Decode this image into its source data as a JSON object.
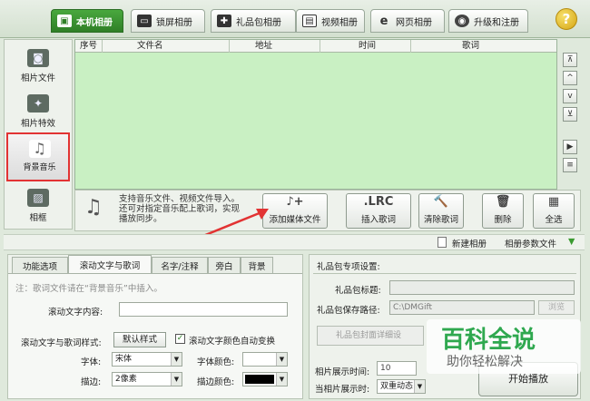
{
  "tabs": [
    {
      "label": "本机相册",
      "icon": "photo-icon",
      "active": true
    },
    {
      "label": "锁屏相册",
      "icon": "monitor-icon"
    },
    {
      "label": "礼品包相册",
      "icon": "gift-icon"
    },
    {
      "label": "视频相册",
      "icon": "film-icon"
    },
    {
      "label": "网页相册",
      "icon": "ie-icon"
    },
    {
      "label": "升级和注册",
      "icon": "globe-icon"
    }
  ],
  "help_label": "?",
  "sidebar": [
    {
      "label": "相片文件",
      "icon": "camera-icon"
    },
    {
      "label": "相片特效",
      "icon": "sparkle-icon"
    },
    {
      "label": "背景音乐",
      "icon": "music-note-icon",
      "selected": true
    },
    {
      "label": "相框",
      "icon": "frame-icon"
    }
  ],
  "table": {
    "columns": [
      "序号",
      "文件名",
      "地址",
      "时间",
      "歌词"
    ]
  },
  "right_buttons": [
    "⊼",
    "^",
    "v",
    "⊻",
    "▶",
    "≡"
  ],
  "toolbar": {
    "hint": "支持音乐文件、视频文件导入。还可对指定音乐配上歌词，实现播放同步。",
    "buttons": [
      {
        "label": "添加媒体文件",
        "icon": "add-music-icon",
        "glyph": "♪+"
      },
      {
        "label": "插入歌词",
        "icon": "lrc-icon",
        "glyph": ".LRC"
      },
      {
        "label": "清除歌词",
        "icon": "hammer-icon",
        "glyph": "🔨"
      },
      {
        "label": "删除",
        "icon": "trash-icon",
        "glyph": "🗑"
      },
      {
        "label": "全选",
        "icon": "grid-icon",
        "glyph": "▦"
      }
    ]
  },
  "statusbar": {
    "new_album": "新建相册",
    "album_params": "相册参数文件"
  },
  "lower_tabs": [
    "功能选项",
    "滚动文字与歌词",
    "名字/注释",
    "旁白",
    "背景"
  ],
  "lower_active_tab": 1,
  "scroll_panel": {
    "note": "注：歌词文件请在“背景音乐”中插入。",
    "content_label": "滚动文字内容:",
    "style_label": "滚动文字与歌词样式:",
    "default_style_btn": "默认样式",
    "auto_color_label": "滚动文字颜色自动变换",
    "font_label": "字体:",
    "font_value": "宋体",
    "font_color_label": "字体颜色:",
    "stroke_label": "描边:",
    "stroke_value": "2像素",
    "stroke_color_label": "描边颜色:"
  },
  "gift_panel": {
    "title": "礼品包专项设置:",
    "gift_title_label": "礼品包标题:",
    "path_label": "礼品包保存路径:",
    "path_value": "C:\\DMGift",
    "browse_label": "浏览",
    "cover_btn": "礼品包封面详细设",
    "display_time_label": "相片展示时间:",
    "display_time_value": "10",
    "anim_label": "当相片展示时:",
    "anim_value": "双重动态",
    "start_btn": "开始播放"
  },
  "watermark": {
    "title": "百科全说",
    "subtitle": "助你轻松解决"
  },
  "colors": {
    "accent": "#3a9a30",
    "highlight": "#e23333",
    "table_bg": "#c9f0c3"
  }
}
